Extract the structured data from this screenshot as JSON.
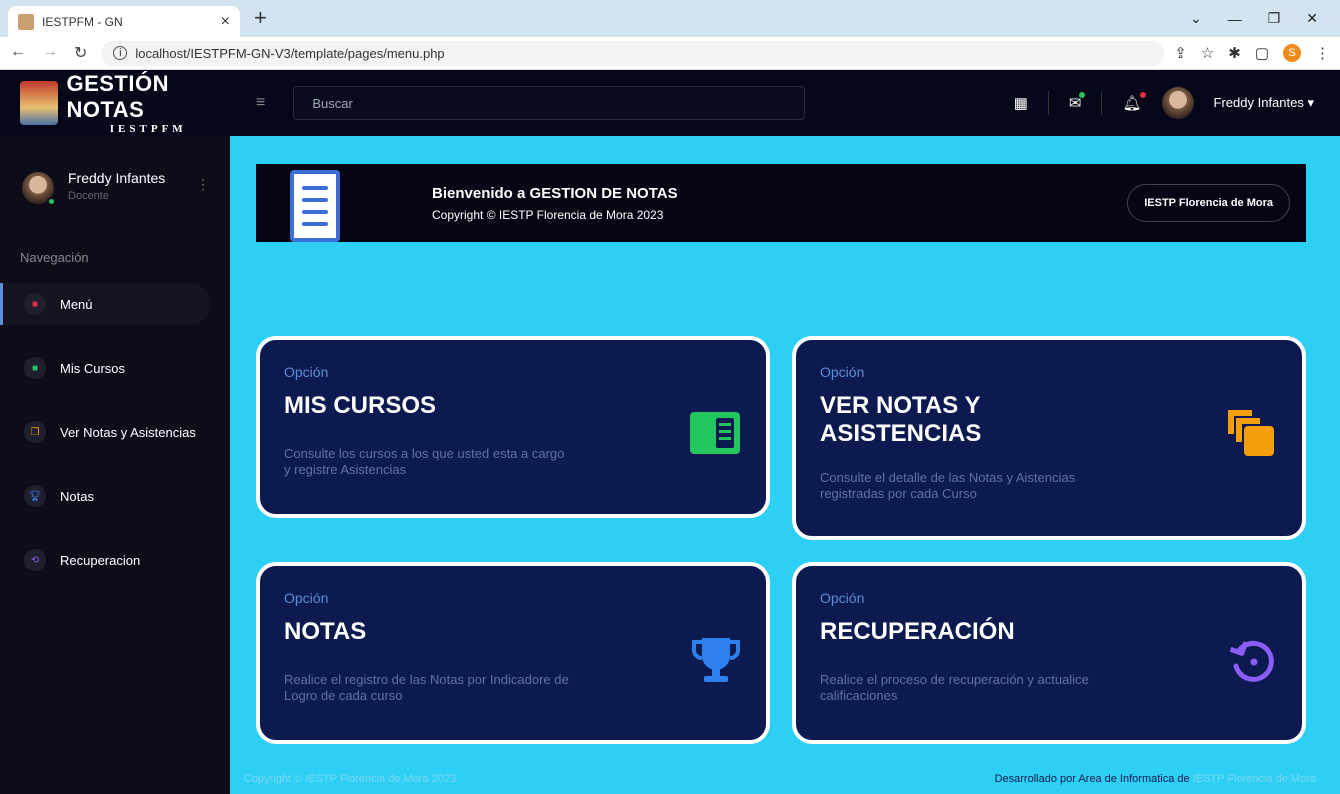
{
  "browser": {
    "tab_title": "IESTPFM - GN",
    "url": "localhost/IESTPFM-GN-V3/template/pages/menu.php",
    "profile_initial": "S"
  },
  "header": {
    "brand_title": "GESTIÓN NOTAS",
    "brand_sub": "IESTPFM",
    "search_placeholder": "Buscar",
    "user_name": "Freddy Infantes"
  },
  "sidebar": {
    "user_name": "Freddy Infantes",
    "user_role": "Docente",
    "nav_heading": "Navegación",
    "items": [
      {
        "label": "Menú",
        "color": "#e0303f"
      },
      {
        "label": "Mis Cursos",
        "color": "#22c55e"
      },
      {
        "label": "Ver Notas y Asistencias",
        "color": "#f59e0b"
      },
      {
        "label": "Notas",
        "color": "#3b82f6"
      },
      {
        "label": "Recuperacion",
        "color": "#8b5cf6"
      }
    ]
  },
  "banner": {
    "title": "Bienvenido a GESTION DE NOTAS",
    "subtitle": "Copyright © IESTP Florencia de Mora 2023",
    "button": "IESTP Florencia de Mora"
  },
  "cards": [
    {
      "option": "Opción",
      "title": "MIS CURSOS",
      "desc": "Consulte los cursos a los que usted esta a cargo y registre Asistencias",
      "icon": "id-card-icon",
      "color": "#22c55e"
    },
    {
      "option": "Opción",
      "title": "VER NOTAS Y ASISTENCIAS",
      "desc": "Consulte el detalle de las Notas y Aistencias registradas por cada Curso",
      "icon": "copy-icon",
      "color": "#f59e0b"
    },
    {
      "option": "Opción",
      "title": "NOTAS",
      "desc": "Realice el registro de las Notas por Indicadore de Logro de cada curso",
      "icon": "trophy-icon",
      "color": "#2f80ed"
    },
    {
      "option": "Opción",
      "title": "RECUPERACIÓN",
      "desc": "Realice el proceso de recuperación y actualice calificaciones",
      "icon": "history-icon",
      "color": "#8b5cf6"
    }
  ],
  "footer": {
    "left": "Copyright © IESTP Florencia de Mora 2023",
    "right_prefix": "Desarrollado por Area de Informatica de",
    "right_link": "IESTP Florencia de Mora"
  }
}
